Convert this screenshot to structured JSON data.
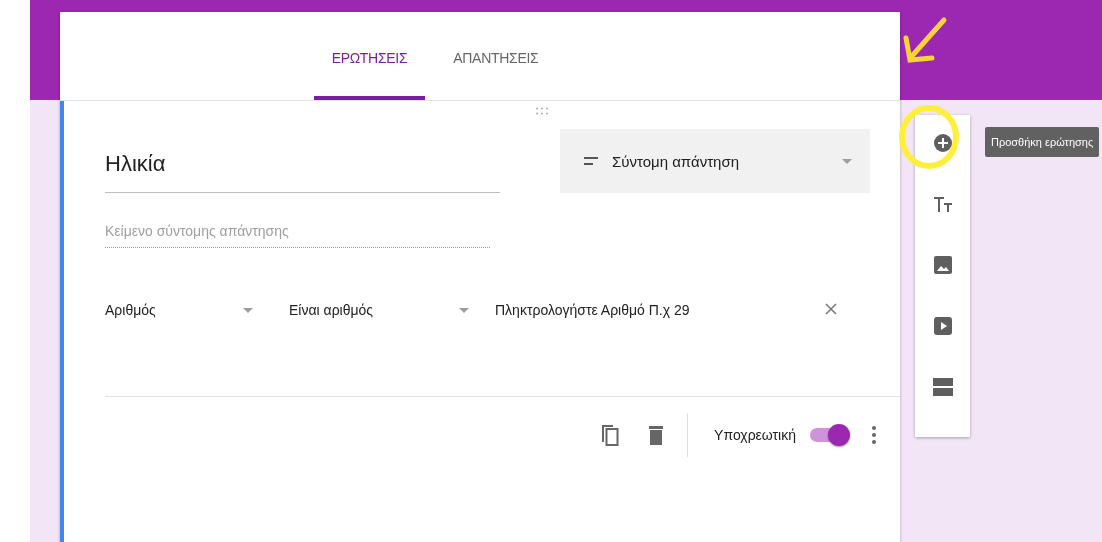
{
  "tabs": [
    {
      "label": "ΕΡΩΤΗΣΕΙΣ",
      "selected": true
    },
    {
      "label": "ΑΠΑΝΤΗΣΕΙΣ",
      "selected": false
    }
  ],
  "question": {
    "title": "Ηλικία",
    "type_label": "Σύντομη απάντηση",
    "answer_placeholder": "Κείμενο σύντομης απάντησης",
    "validation": {
      "field": "Αριθμός",
      "condition": "Είναι αριθμός",
      "value": "Πληκτρολογήστε Αριθμό Π.χ 29"
    },
    "required_label": "Υποχρεωτική",
    "required": true
  },
  "toolbar": [
    {
      "kind": "add"
    },
    {
      "kind": "title"
    },
    {
      "kind": "image"
    },
    {
      "kind": "video"
    },
    {
      "kind": "section"
    }
  ],
  "tooltip": "Προσθήκη ερώτησης"
}
